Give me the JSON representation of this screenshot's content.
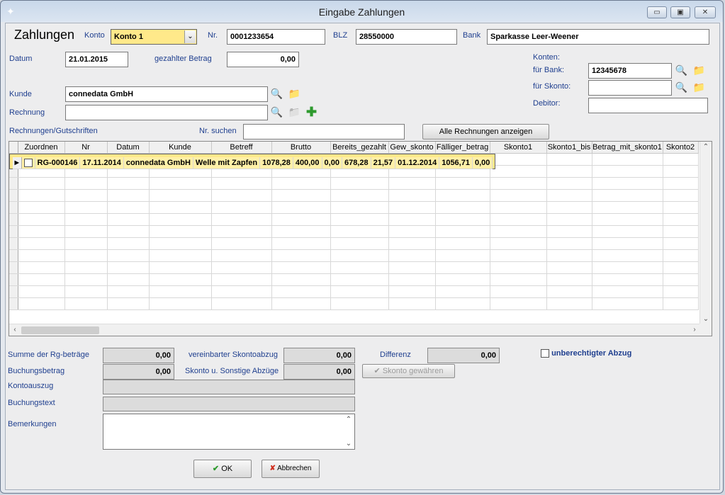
{
  "window": {
    "title": "Eingabe Zahlungen"
  },
  "header": {
    "heading": "Zahlungen",
    "konto_label": "Konto",
    "konto_value": "Konto 1",
    "nr_label": "Nr.",
    "nr_value": "0001233654",
    "blz_label": "BLZ",
    "blz_value": "28550000",
    "bank_label": "Bank",
    "bank_value": "Sparkasse Leer-Weener"
  },
  "form": {
    "datum_label": "Datum",
    "datum_value": "21.01.2015",
    "betrag_label": "gezahlter Betrag",
    "betrag_value": "0,00",
    "konten_label": "Konten:",
    "fuer_bank_label": "für Bank:",
    "fuer_bank_value": "12345678",
    "fuer_skonto_label": "für Skonto:",
    "fuer_skonto_value": "",
    "debitor_label": "Debitor:",
    "debitor_value": "",
    "kunde_label": "Kunde",
    "kunde_value": "connedata GmbH",
    "rechnung_label": "Rechnung",
    "rechnung_value": "",
    "rechnungen_label": "Rechnungen/Gutschriften",
    "nr_suchen_label": "Nr. suchen",
    "nr_suchen_value": "",
    "alle_button": "Alle Rechnungen anzeigen"
  },
  "grid": {
    "columns": [
      "Zuordnen",
      "Nr",
      "Datum",
      "Kunde",
      "Betreff",
      "Brutto",
      "Bereits_gezahlt",
      "Gew_skonto",
      "Fälliger_betrag",
      "Skonto1",
      "Skonto1_bis",
      "Betrag_mit_skonto1",
      "Skonto2"
    ],
    "rows": [
      {
        "zuordnen": false,
        "nr": "RG-000146",
        "datum": "17.11.2014",
        "kunde": "connedata GmbH",
        "betreff": "Welle mit Zapfen",
        "brutto": "1078,28",
        "bereits_gezahlt": "400,00",
        "gew_skonto": "0,00",
        "faelliger_betrag": "678,28",
        "skonto1": "21,57",
        "skonto1_bis": "01.12.2014",
        "betrag_mit_skonto1": "1056,71",
        "skonto2": "0,00"
      }
    ],
    "empty_rows": 13
  },
  "summary": {
    "summe_label": "Summe der Rg-beträge",
    "summe_value": "0,00",
    "buchungsbetrag_label": "Buchungsbetrag",
    "buchungsbetrag_value": "0,00",
    "skontoabzug_label": "vereinbarter Skontoabzug",
    "skontoabzug_value": "0,00",
    "sonstige_label": "Skonto u. Sonstige Abzüge",
    "sonstige_value": "0,00",
    "differenz_label": "Differenz",
    "differenz_value": "0,00",
    "unberechtigt_label": "unberechtigter Abzug",
    "skonto_gewaehren": "Skonto gewähren",
    "kontoauszug_label": "Kontoauszug",
    "kontoauszug_value": "",
    "buchungstext_label": "Buchungstext",
    "buchungstext_value": "",
    "bemerkungen_label": "Bemerkungen",
    "bemerkungen_value": ""
  },
  "footer": {
    "ok": "OK",
    "abbrechen": "Abbrechen"
  },
  "colors": {
    "accent_label": "#1f3f8f",
    "selected_row": "#fff0a8",
    "combo": "#ffe98a"
  }
}
